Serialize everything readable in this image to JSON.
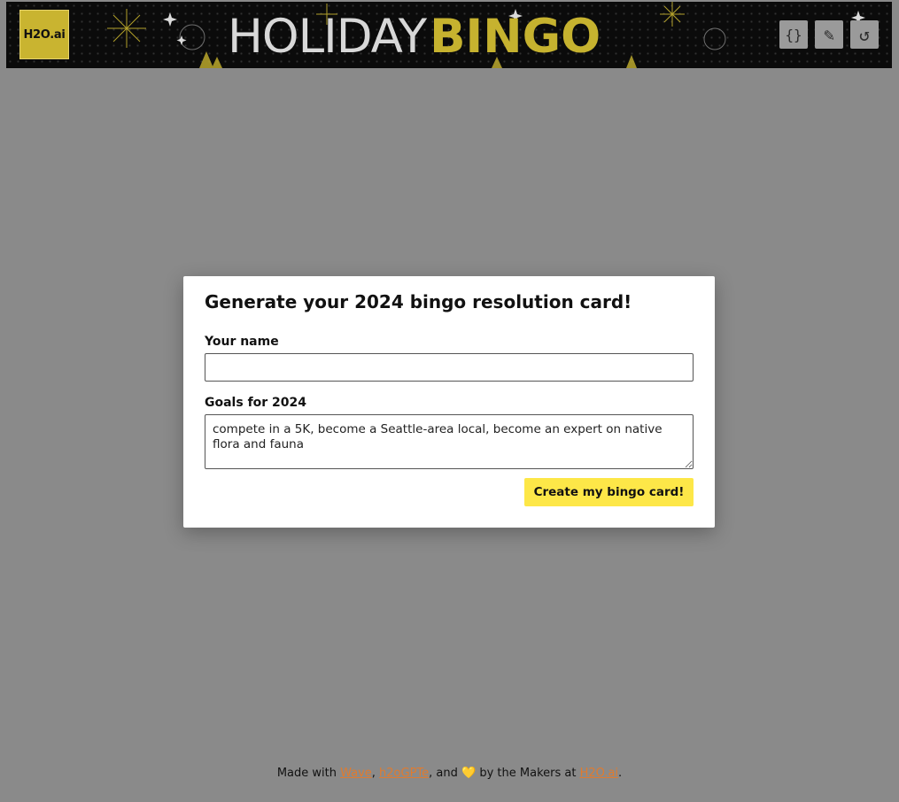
{
  "header": {
    "logo_text": "H2O.ai",
    "title_light": "HOLIDAY",
    "title_bold": "BINGO",
    "actions": [
      {
        "icon": "braces-icon",
        "glyph": "{}"
      },
      {
        "icon": "pencil-icon",
        "glyph": "✎"
      },
      {
        "icon": "undo-icon",
        "glyph": "↺"
      }
    ]
  },
  "dialog": {
    "title": "Generate your 2024 bingo resolution card!",
    "name_label": "Your name",
    "name_value": "",
    "goals_label": "Goals for 2024",
    "goals_value": "compete in a 5K, become a Seattle-area local, become an expert on native flora and fauna",
    "submit_label": "Create my bingo card!"
  },
  "footer": {
    "prefix": "Made with ",
    "link1": "Wave",
    "sep1": ", ",
    "link2": "h2oGPTe",
    "sep2": ", and ",
    "heart": "💛",
    "mid": " by the Makers at ",
    "link3": "H2O.ai",
    "end": "."
  },
  "colors": {
    "backdrop": "#8a8a8a",
    "banner_bg": "#0b0b0b",
    "gold": "#c6b22f",
    "button_yellow": "#fde748",
    "link_orange": "#e07b2f"
  }
}
